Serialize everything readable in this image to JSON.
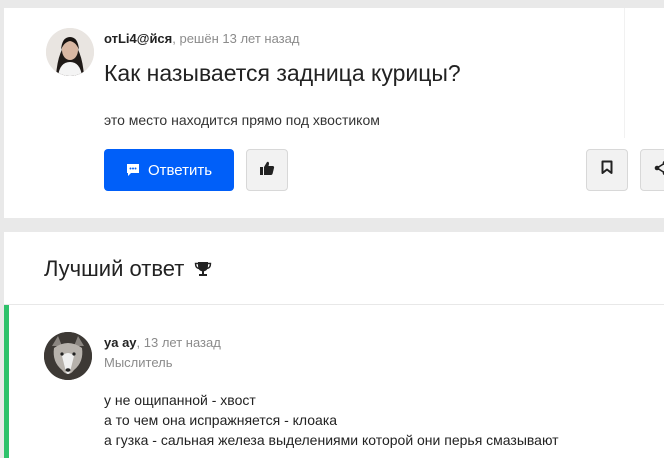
{
  "question": {
    "author": "отLi4@йся",
    "meta": ", решён 13 лет назад",
    "title": "Как называется задница курицы?",
    "body": "это место находится прямо под хвостиком",
    "answer_button_label": "Ответить",
    "icons": {
      "answer": "comment-icon",
      "like": "thumbs-up-icon",
      "bookmark": "bookmark-icon",
      "share": "share-icon"
    }
  },
  "best_answer": {
    "heading": "Лучший ответ",
    "heading_icon": "trophy-icon",
    "author": "ya ay",
    "meta": ", 13 лет назад",
    "rank": "Мыслитель",
    "lines": [
      "у не ощипанной - хвост",
      "а то чем она испражняется - клоака",
      "а гузка - сальная железа выделениями которой они перья смазывают"
    ]
  },
  "colors": {
    "accent": "#005ff9",
    "best_answer_bar": "#2fc26b"
  }
}
